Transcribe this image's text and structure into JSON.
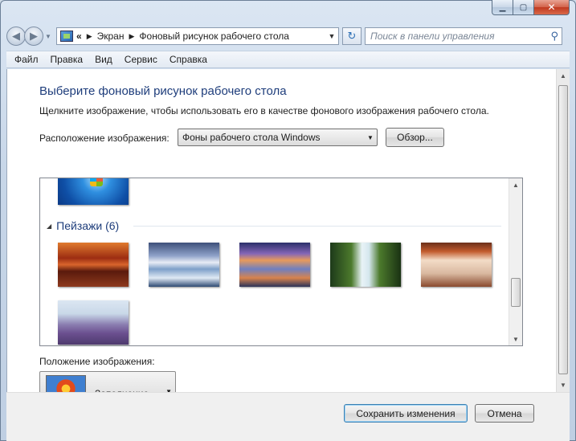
{
  "window": {
    "caption": {
      "minimize_icon": "minimize-icon",
      "maximize_icon": "maximize-icon",
      "close_icon": "close-icon"
    }
  },
  "nav": {
    "back_icon": "back-arrow-icon",
    "forward_icon": "forward-arrow-icon",
    "breadcrumb_overflow": "«",
    "breadcrumb": [
      "Экран",
      "Фоновый рисунок рабочего стола"
    ],
    "refresh_icon": "refresh-icon",
    "search_placeholder": "Поиск в панели управления",
    "search_icon": "magnifier-icon"
  },
  "menu": [
    "Файл",
    "Правка",
    "Вид",
    "Сервис",
    "Справка"
  ],
  "page": {
    "title": "Выберите фоновый рисунок рабочего стола",
    "subtitle": "Щелкните изображение, чтобы использовать его в качестве фонового изображения рабочего стола.",
    "location_label": "Расположение изображения:",
    "location_value": "Фоны рабочего стола Windows",
    "browse_label": "Обзор...",
    "group_label": "Пейзажи (6)",
    "position_label": "Положение изображения:",
    "position_value": "Заполнение"
  },
  "gallery": {
    "images": [
      "Windows 7 logo",
      "Canyon",
      "Icy lake",
      "Coast sunset",
      "Waterfall",
      "Arch",
      "Lavender field"
    ]
  },
  "buttons": {
    "save": "Сохранить изменения",
    "cancel": "Отмена"
  }
}
